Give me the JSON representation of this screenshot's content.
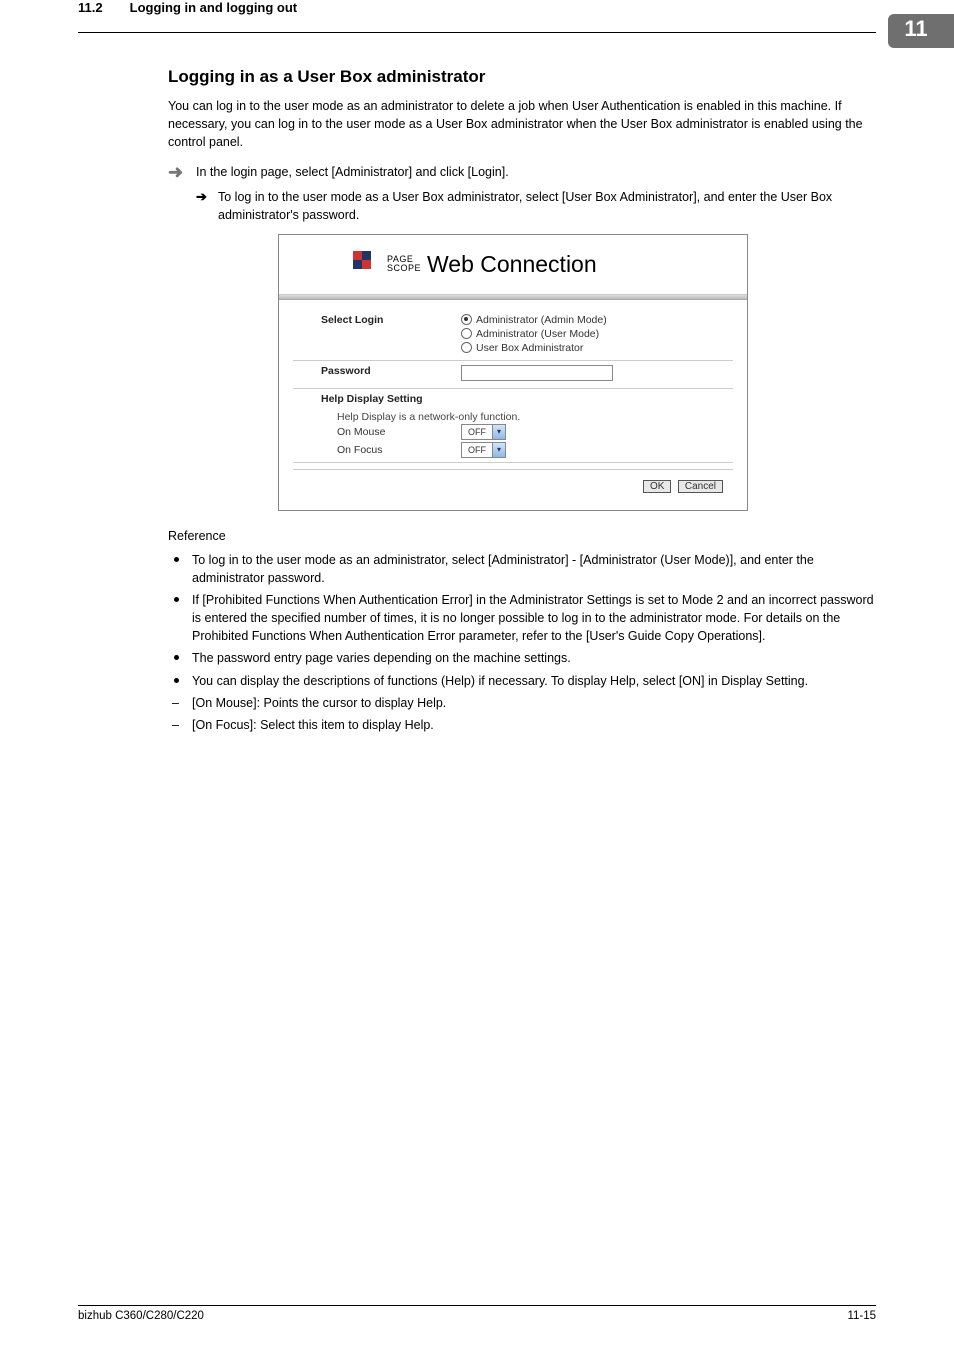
{
  "header": {
    "section_number": "11.2",
    "section_title": "Logging in and logging out",
    "chapter_badge": "11"
  },
  "title": "Logging in as a User Box administrator",
  "intro": "You can log in to the user mode as an administrator to delete a job when User Authentication is enabled in this machine. If necessary, you can log in to the user mode as a User Box administrator when the User Box administrator is enabled using the control panel.",
  "step_main": "In the login page, select [Administrator] and click [Login].",
  "step_sub": "To log in to the user mode as a User Box administrator, select [User Box Administrator], and enter the User Box administrator's password.",
  "panel": {
    "logo_small": "PAGE\nSCOPE",
    "logo_big": "Web Connection",
    "select_login_label": "Select Login",
    "radios": [
      {
        "label": "Administrator (Admin Mode)",
        "selected": true
      },
      {
        "label": "Administrator (User Mode)",
        "selected": false
      },
      {
        "label": "User Box Administrator",
        "selected": false
      }
    ],
    "password_label": "Password",
    "help_setting_label": "Help Display Setting",
    "help_note": "Help Display is a network-only function.",
    "on_mouse_label": "On Mouse",
    "on_focus_label": "On Focus",
    "select_value": "OFF",
    "ok_label": "OK",
    "cancel_label": "Cancel"
  },
  "reference_title": "Reference",
  "reference": [
    {
      "type": "bullet",
      "text": "To log in to the user mode as an administrator, select [Administrator] - [Administrator (User Mode)], and enter the administrator password."
    },
    {
      "type": "bullet",
      "text": "If [Prohibited Functions When Authentication Error] in the Administrator Settings is set to Mode 2 and an incorrect password is entered the specified number of times, it is no longer possible to log in to the administrator mode. For details on the Prohibited Functions When Authentication Error parameter, refer to the [User's Guide Copy Operations]."
    },
    {
      "type": "bullet",
      "text": "The password entry page varies depending on the machine settings."
    },
    {
      "type": "bullet",
      "text": "You can display the descriptions of functions (Help) if necessary. To display Help, select [ON] in Display Setting."
    },
    {
      "type": "dash",
      "text": "[On Mouse]: Points the cursor to display Help."
    },
    {
      "type": "dash",
      "text": "[On Focus]: Select this item to display Help."
    }
  ],
  "footer": {
    "left": "bizhub C360/C280/C220",
    "right": "11-15"
  }
}
